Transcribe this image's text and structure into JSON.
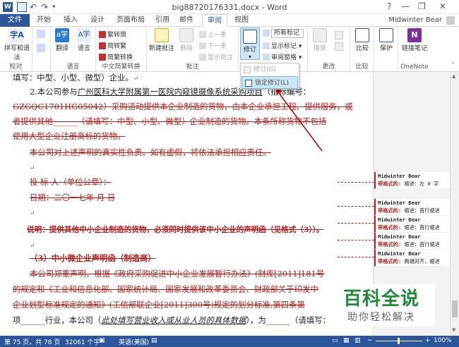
{
  "titlebar": {
    "title": "big88720176331.docx - Word",
    "help": "?",
    "minimize": "—",
    "restore": "❐",
    "close": "✕"
  },
  "tabs": [
    {
      "label": "文件"
    },
    {
      "label": "开始"
    },
    {
      "label": "插入"
    },
    {
      "label": "设计"
    },
    {
      "label": "页面布局"
    },
    {
      "label": "引用"
    },
    {
      "label": "邮件"
    },
    {
      "label": "审阅"
    },
    {
      "label": "视图"
    }
  ],
  "user": "Midwinter Bear",
  "ribbon": {
    "groups": {
      "proofing": "校对",
      "language": "语言",
      "chinese": "中文简繁转换",
      "comments": "批注",
      "tracking": "修订",
      "changes": "更改",
      "compare": "比较",
      "protect": "",
      "onenote": "OneNote"
    },
    "spell": "拼写和语法",
    "translate": "翻译",
    "language": "语言",
    "to_trad": "繁转简",
    "to_simp": "简转繁",
    "convert": "简繁转换",
    "new_comment": "新建批注",
    "delete": "删除",
    "prev": "上一条",
    "next": "下一条",
    "show_comments": "显示批注",
    "track": "修订",
    "markup": "所有标记",
    "show_markup": "显示标记",
    "pane": "审阅窗格",
    "accept": "接受",
    "compare": "比较",
    "protect": "保护",
    "linked_notes": "链接笔记"
  },
  "popup": {
    "track": "修订(G)",
    "lock": "锁定修订(L)"
  },
  "doc": {
    "l1": "填写：中型、小型、微型）企业。",
    "l2a": "2.本公司参与",
    "l2b": "广州医科大学附属第一医院内窥镜摄像系统采购项目",
    "l2c": "（招标编号：",
    "l3": "GZGQC1701HG05042）采购活动提供本企业制造的货物，由本企业承担工程、提供服务，或",
    "l4": "者提供其他______（请填写：中型、小型、微型）企业制造的货物。本条所称货物不包括",
    "l5": "使用大型企业注册商标的货物。",
    "l6": "本公司对上述声明的真实性负责。如有虚假，将依法承担相应责任。",
    "l8": "投  标  人（单位公章）：",
    "l9": "日期：二〇一七年    月    日",
    "l10": "说明：提供其他中小企业制造的货物，必须同时提供该中小企业的声明函（见格式（3））。",
    "l11": "（3）中小微企业声明函（制造商）",
    "l12": "本公司郑重声明，根据《政府采购促进中小企业发展暂行办法》(财库[2011]181号",
    "l13": "的规定和《工业和信息化部、国家统计局、国家发展和改革委员会、财政部关于印发中",
    "l14": "企业划型标准规定的通知》(工信部联企业[2011]300号)规定的划分标准,第四条第",
    "l15a": "项______行业，本公司（",
    "l15b": "此处填写营业收入或从业人员的具体数据",
    "l15c": "），为______（请填写："
  },
  "bubbles": [
    {
      "author": "Midwinter Bear",
      "label": "带格式的:",
      "text": "缩进：左  0 字"
    },
    {
      "author": "Midwinter Bear",
      "label": "带格式的:",
      "text": "缩进：首行缩进"
    },
    {
      "author": "Midwinter Bear",
      "label": "带格式的:",
      "text": "缩进：首行缩进"
    },
    {
      "author": "Midwinter Bear",
      "label": "带格式的:",
      "text": "缩进：首行缩进"
    },
    {
      "author": "Midwinter Bear",
      "label": "带格式的:",
      "text": "两端对齐，缩进"
    }
  ],
  "status": {
    "page": "第 75 页，共 78 页",
    "words": "32061 个字",
    "lang": "英语(美国)",
    "zoom": "100%",
    "minus": "−",
    "plus": "+"
  },
  "watermark": {
    "title": "百科全说",
    "sub": "助你轻松解决"
  },
  "colors": {
    "accent": "#2b579a",
    "deleted": "#b41f1f",
    "watermark": "#1f8a3a"
  }
}
